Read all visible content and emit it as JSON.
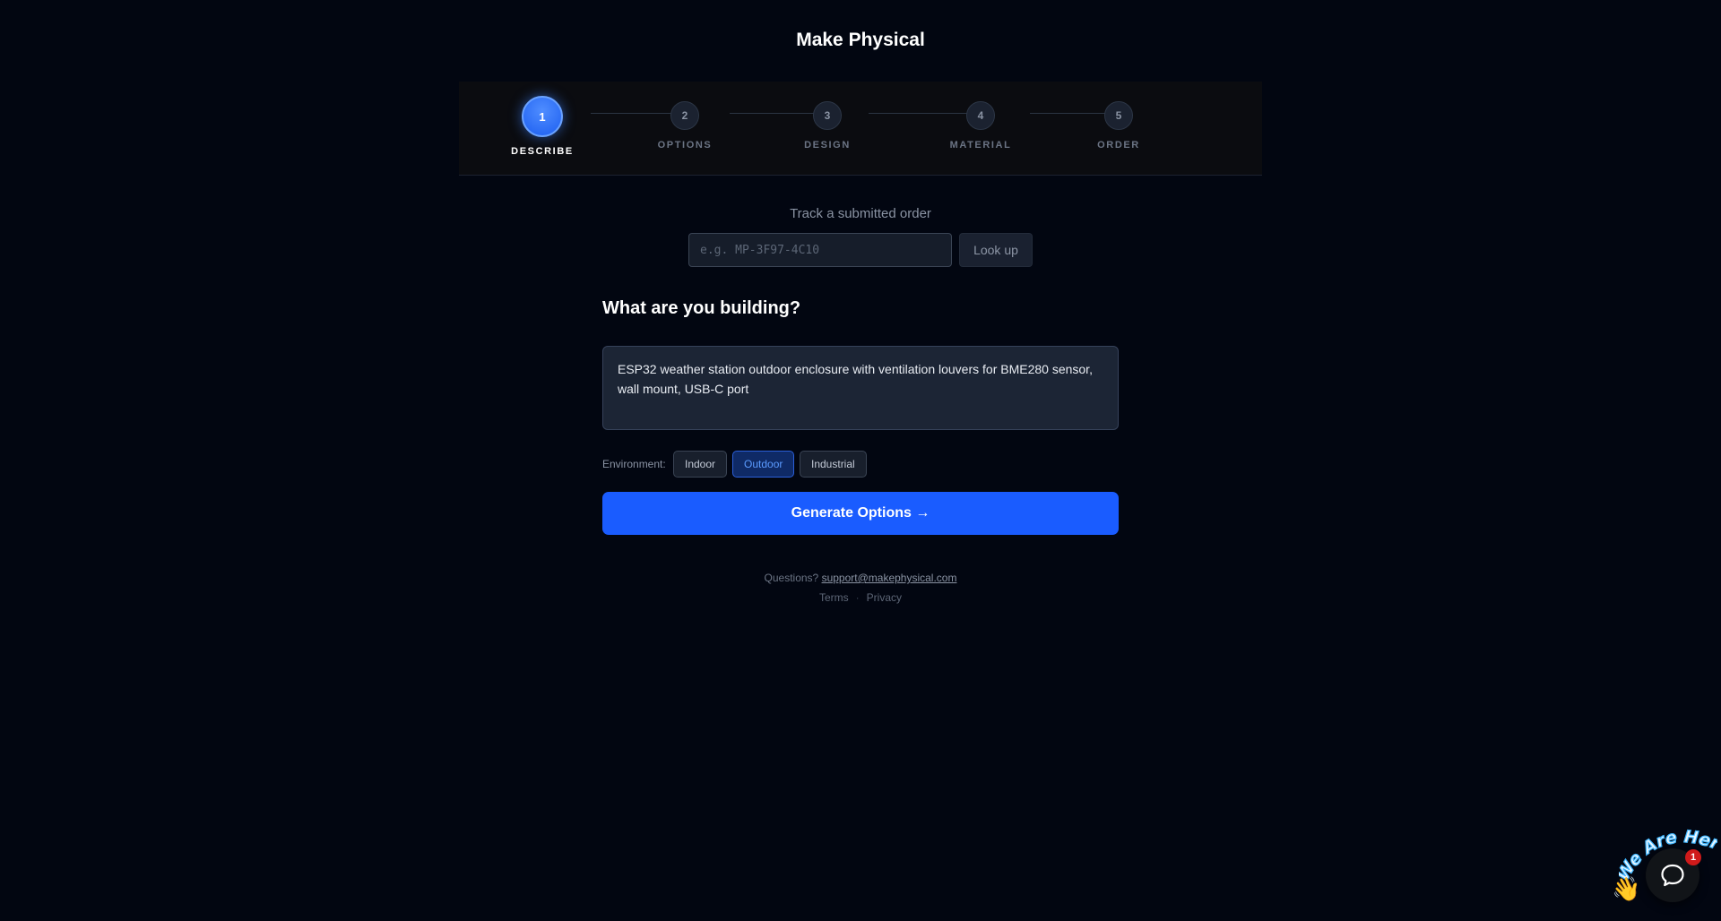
{
  "app": {
    "title": "Make Physical"
  },
  "stepper": {
    "steps": [
      {
        "number": "1",
        "label": "DESCRIBE",
        "state": "active"
      },
      {
        "number": "2",
        "label": "OPTIONS",
        "state": "inactive"
      },
      {
        "number": "3",
        "label": "DESIGN",
        "state": "inactive"
      },
      {
        "number": "4",
        "label": "MATERIAL",
        "state": "inactive"
      },
      {
        "number": "5",
        "label": "ORDER",
        "state": "inactive"
      }
    ]
  },
  "track": {
    "label": "Track a submitted order",
    "placeholder": "e.g. MP-3F97-4C10",
    "value": "",
    "button_label": "Look up"
  },
  "builder": {
    "heading": "What are you building?",
    "description": "ESP32 weather station outdoor enclosure with ventilation louvers for BME280 sensor, wall mount, USB-C port"
  },
  "environment": {
    "label": "Environment:",
    "options": [
      "Indoor",
      "Outdoor",
      "Industrial"
    ],
    "selected": "Outdoor"
  },
  "generate": {
    "label": "Generate Options →"
  },
  "footer": {
    "questions_prefix": "Questions?",
    "support_email": "support@makephysical.com",
    "terms": "Terms",
    "separator": "·",
    "privacy": "Privacy"
  },
  "chat_widget": {
    "banner_text": "We Are Here!",
    "wave_icon": "waving-hand-icon",
    "chat_icon": "chat-bubble-icon",
    "unread_count": "1"
  },
  "colors": {
    "background": "#020611",
    "accent": "#1a5cff",
    "selected_option": "#5b9bff",
    "badge": "#d01a1a"
  }
}
